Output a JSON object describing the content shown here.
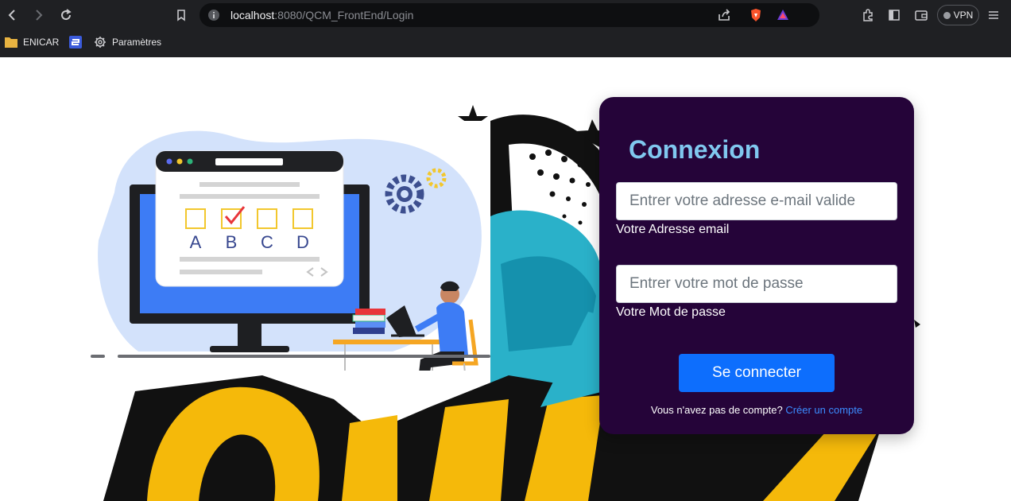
{
  "browser": {
    "url_host": "localhost",
    "url_path": ":8080/QCM_FrontEnd/Login",
    "vpn_label": "VPN",
    "icons": [
      "back-icon",
      "forward-icon",
      "reload-icon",
      "bookmark-icon",
      "info-icon",
      "share-icon",
      "brave-shields-icon",
      "brave-rewards-icon",
      "extensions-icon",
      "sidebar-icon",
      "wallet-icon",
      "menu-icon"
    ]
  },
  "bookmarks": [
    {
      "label": "ENICAR",
      "icon": "folder-icon"
    },
    {
      "label": "",
      "icon": "app-shortcut-icon"
    },
    {
      "label": "Paramètres",
      "icon": "gear-icon"
    }
  ],
  "illustration": {
    "options": [
      "A",
      "B",
      "C",
      "D"
    ]
  },
  "login": {
    "title": "Connexion",
    "email_placeholder": "Entrer votre adresse e-mail valide",
    "email_label": "Votre Adresse email",
    "password_placeholder": "Entrer votre mot de passe",
    "password_label": "Votre Mot de passe",
    "submit_label": "Se connecter",
    "signup_prompt": "Vous n'avez pas de compte?",
    "signup_link": "Créer un compte"
  },
  "colors": {
    "card_bg": "#250439",
    "title": "#80c8ef",
    "button": "#0d6efd",
    "link": "#3b8cff"
  }
}
